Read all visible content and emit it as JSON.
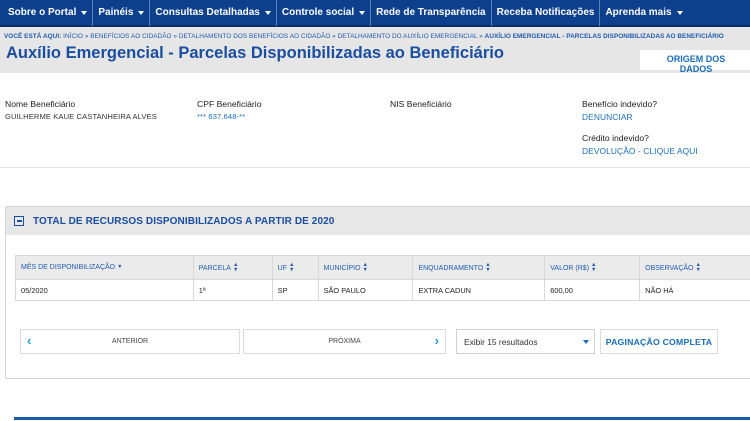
{
  "nav": {
    "items": [
      {
        "label": "Sobre o Portal",
        "caret": true
      },
      {
        "label": "Painéis",
        "caret": true
      },
      {
        "label": "Consultas Detalhadas",
        "caret": true
      },
      {
        "label": "Controle social",
        "caret": true
      },
      {
        "label": "Rede de Transparência",
        "caret": false
      },
      {
        "label": "Receba Notificações",
        "caret": false
      },
      {
        "label": "Aprenda mais",
        "caret": true
      }
    ]
  },
  "breadcrumb": {
    "label": "VOCÊ ESTÁ AQUI:",
    "items": [
      "INÍCIO",
      "BENEFÍCIOS AO CIDADÃO",
      "DETALHAMENTO DOS BENEFÍCIOS AO CIDADÃO",
      "DETALHAMENTO DO AUXÍLIO EMERGENCIAL"
    ],
    "current": "AUXÍLIO EMERGENCIAL - PARCELAS DISPONIBILIZADAS AO BENEFICIÁRIO",
    "separator": "»"
  },
  "page_title": "Auxílio Emergencial - Parcelas Disponibilizadas ao Beneficiário",
  "origem_button": "ORIGEM DOS DADOS",
  "fields": {
    "nome": {
      "label": "Nome Beneficiário",
      "value": "GUILHERME KAUE CASTANHEIRA ALVES"
    },
    "cpf": {
      "label": "CPF Beneficiário",
      "value": "*** 637.648-**"
    },
    "nis": {
      "label": "NIS Beneficiário",
      "value": ""
    },
    "beneficio": {
      "label": "Benefício indevido?",
      "link": "DENUNCIAR"
    },
    "credito": {
      "label": "Crédito indevido?",
      "link": "DEVOLUÇÃO - CLIQUE AQUI"
    }
  },
  "panel": {
    "title": "TOTAL DE RECURSOS DISPONIBILIZADOS A PARTIR DE 2020",
    "columns": [
      "MÊS DE DISPONIBILIZAÇÃO",
      "PARCELA",
      "UF",
      "MUNICÍPIO",
      "ENQUADRAMENTO",
      "VALOR (R$)",
      "OBSERVAÇÃO"
    ],
    "rows": [
      [
        "05/2020",
        "1ª",
        "SP",
        "SÃO PAULO",
        "EXTRA CADUN",
        "600,00",
        "NÃO HÁ"
      ]
    ]
  },
  "pagination": {
    "prev": "ANTERIOR",
    "next": "PRÓXIMA",
    "page_size": "Exibir 15 resultados",
    "full": "PAGINAÇÃO COMPLETA"
  },
  "colors": {
    "nav_bg": "#0c3f8c",
    "title": "#1a4ea1",
    "link": "#1a6db8"
  }
}
